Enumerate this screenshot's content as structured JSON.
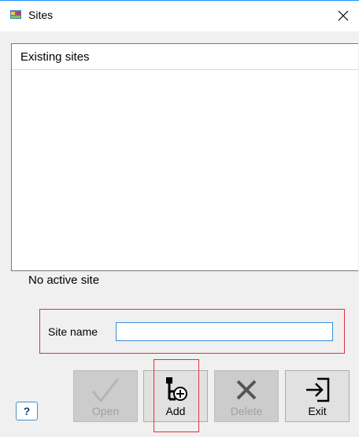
{
  "window": {
    "title": "Sites",
    "icon": "sites-app-icon",
    "close_icon": "close-icon"
  },
  "list": {
    "header": "Existing sites",
    "items": []
  },
  "status": {
    "active_site": "No active site"
  },
  "site_name": {
    "label": "Site name",
    "value": "",
    "placeholder": ""
  },
  "help": {
    "label": "?"
  },
  "toolbar": {
    "open_label": "Open",
    "add_label": "Add",
    "delete_label": "Delete",
    "exit_label": "Exit"
  },
  "colors": {
    "highlight": "#e0323c",
    "input_focus": "#3b8fd9",
    "titlebar_accent": "#1e90ff"
  }
}
